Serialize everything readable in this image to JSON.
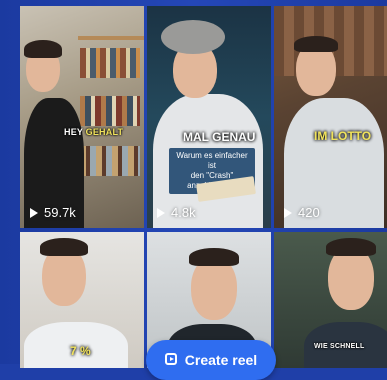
{
  "reels": [
    {
      "caption_white": "HEY ",
      "caption_yellow": "GEHALT",
      "views": "59.7k"
    },
    {
      "caption_big": "MAL GENAU",
      "subtitle_line1": "Warum es einfacher ist",
      "subtitle_line2": "den \"Crash\" anzukündigen",
      "views": "4.8k"
    },
    {
      "caption_big_yellow": "IM LOTTO",
      "views": "420"
    },
    {
      "caption_big_yellow": "7 %"
    },
    {},
    {
      "caption_white": "WIE SCHNELL"
    }
  ],
  "create_button": {
    "label": "Create reel",
    "icon": "reel-icon"
  }
}
